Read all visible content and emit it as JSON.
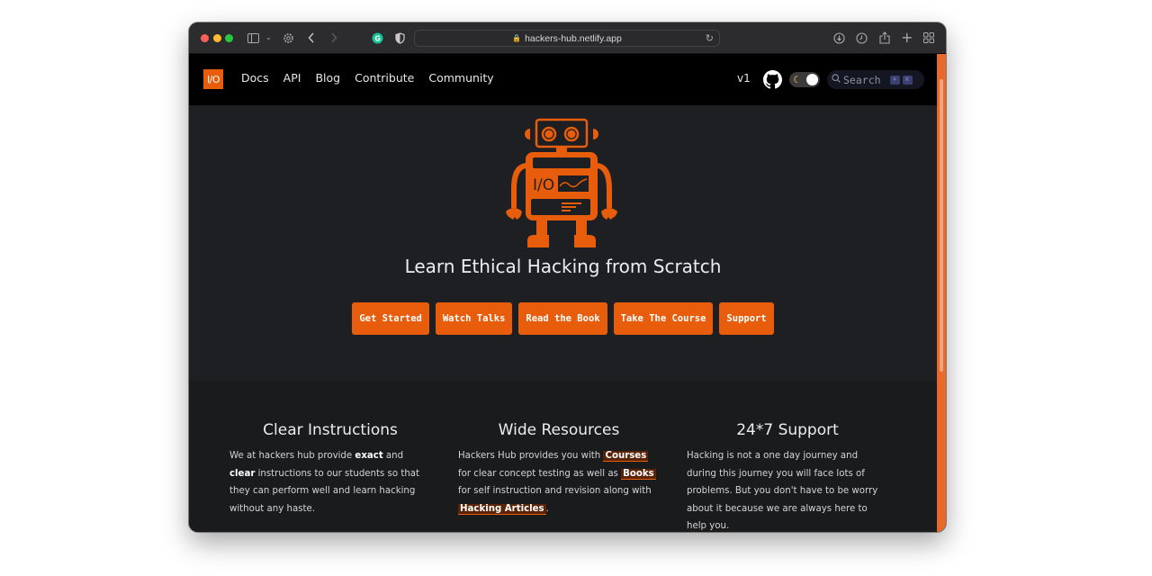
{
  "browser": {
    "url": "hackers-hub.netlify.app",
    "icons": [
      "sidebar-icon",
      "chevron-down-icon",
      "settings-icon",
      "back-icon",
      "forward-icon",
      "grammarly-icon",
      "privacy-shield-icon",
      "lock-icon",
      "reload-icon",
      "download-icon",
      "history-icon",
      "share-icon",
      "new-tab-icon",
      "tab-overview-icon"
    ]
  },
  "nav": {
    "logo_text": "I/O",
    "links": [
      "Docs",
      "API",
      "Blog",
      "Contribute",
      "Community"
    ],
    "version": "v1",
    "search_placeholder": "Search",
    "search_keys": [
      "⌘",
      "K"
    ]
  },
  "hero": {
    "robot_label": "I/O",
    "title": "Learn Ethical Hacking from Scratch",
    "buttons": [
      "Get Started",
      "Watch Talks",
      "Read the Book",
      "Take The Course",
      "Support"
    ]
  },
  "features": [
    {
      "title": "Clear Instructions",
      "text_1": "We at hackers hub provide ",
      "bold_1": "exact",
      "text_2": " and ",
      "bold_2": "clear",
      "text_3": " instructions to our students so that they can perform well and learn hacking without any haste."
    },
    {
      "title": "Wide Resources",
      "text_1": "Hackers Hub provides you with ",
      "link_1": "Courses",
      "text_2": " for clear concept testing as well as ",
      "link_2": "Books",
      "text_3": " for self instruction and revision along with ",
      "link_3": "Hacking Articles",
      "text_4": "."
    },
    {
      "title": "24*7 Support",
      "text_1": "Hacking is not a one day journey and during this journey you will face lots of problems. But you don't have to be worry about it because we are always here to help you."
    }
  ],
  "colors": {
    "accent": "#e85d0c",
    "nav_bg": "#000000",
    "hero_bg": "#1e1f23",
    "features_bg": "#1a1b1d"
  }
}
